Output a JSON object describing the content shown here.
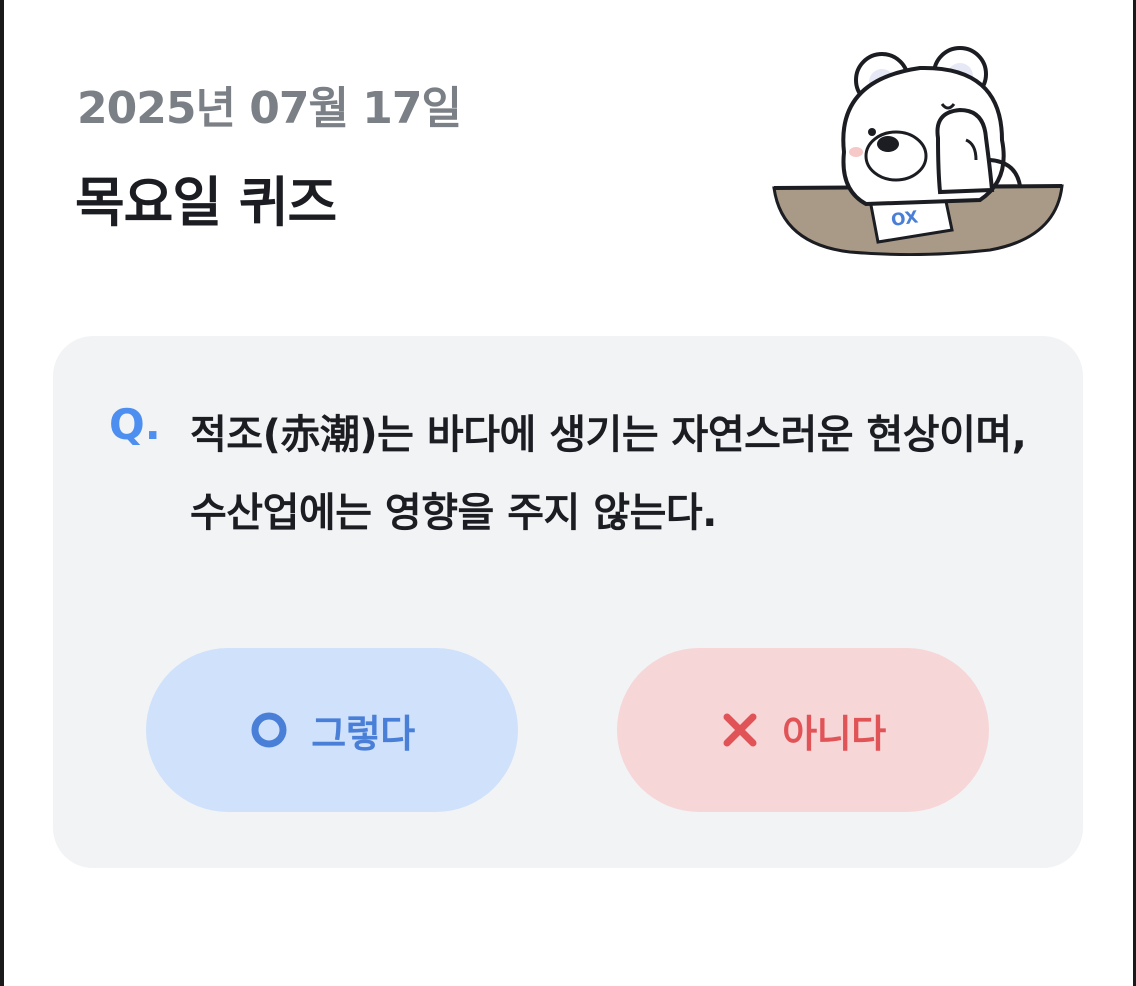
{
  "header": {
    "date": "2025년 07월 17일",
    "title": "목요일 퀴즈"
  },
  "mascot": {
    "icon": "bear-mascot-icon",
    "sheet_text": "OX"
  },
  "quiz": {
    "prefix": "Q.",
    "question": "적조(赤潮)는 바다에 생기는 자연스러운 현상이며, 수산업에는 영향을 주지 않는다."
  },
  "answers": {
    "yes": {
      "label": "그렇다",
      "icon": "circle-o-icon",
      "color": "#4a7fd8",
      "background": "#cfe1fb"
    },
    "no": {
      "label": "아니다",
      "icon": "x-mark-icon",
      "color": "#e05457",
      "background": "#f7d6d8"
    }
  },
  "colors": {
    "accent_blue": "#4d8ff0",
    "card_background": "#f2f3f5",
    "date_gray": "#7b7f86"
  }
}
